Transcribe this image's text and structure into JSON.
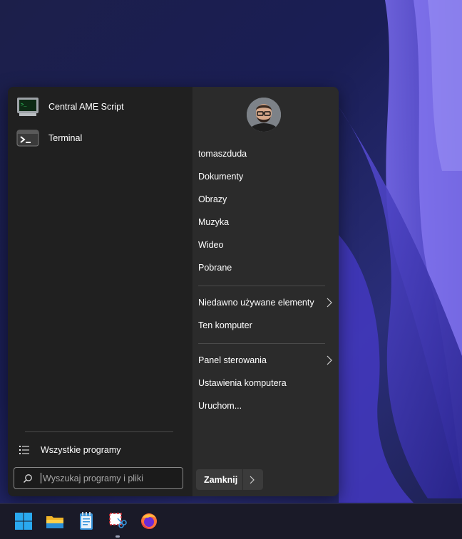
{
  "start_menu": {
    "pinned": [
      {
        "label": "Central AME Script",
        "icon": "monitor-green-icon"
      },
      {
        "label": "Terminal",
        "icon": "terminal-icon"
      }
    ],
    "all_programs_label": "Wszystkie programy",
    "search": {
      "placeholder": "Wyszukaj programy i pliki"
    },
    "right": {
      "username": "tomaszduda",
      "items": [
        {
          "label": "Dokumenty"
        },
        {
          "label": "Obrazy"
        },
        {
          "label": "Muzyka"
        },
        {
          "label": "Wideo"
        },
        {
          "label": "Pobrane"
        },
        {
          "label": "Niedawno używane elementy",
          "submenu": true
        },
        {
          "label": "Ten komputer"
        },
        {
          "label": "Panel sterowania",
          "submenu": true
        },
        {
          "label": "Ustawienia komputera"
        },
        {
          "label": "Uruchom..."
        }
      ],
      "shutdown_label": "Zamknij"
    }
  },
  "taskbar": {
    "apps": [
      {
        "name": "windows-start-icon"
      },
      {
        "name": "file-explorer-icon"
      },
      {
        "name": "notepad-icon"
      },
      {
        "name": "snipping-tool-icon"
      },
      {
        "name": "firefox-icon"
      }
    ]
  },
  "colors": {
    "accent": "#3a7bd5",
    "menu_left": "#202020",
    "menu_right": "#2b2b2b",
    "wallpaper": "#1c1f4a"
  }
}
